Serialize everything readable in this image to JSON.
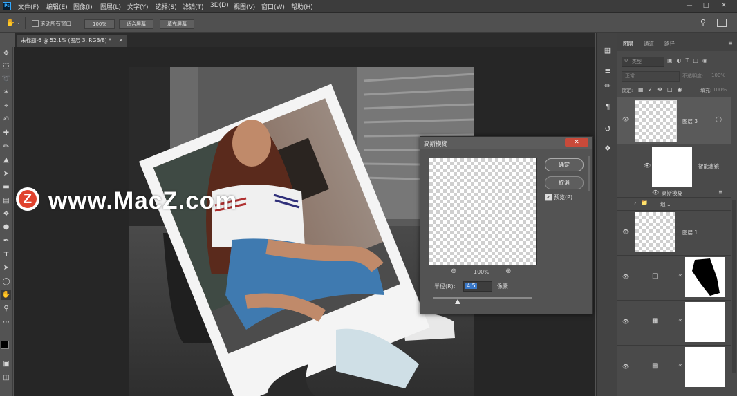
{
  "app": {
    "logo": "Ps"
  },
  "menubar": {
    "items": [
      "文件(F)",
      "编辑(E)",
      "图像(I)",
      "图层(L)",
      "文字(Y)",
      "选择(S)",
      "滤镜(T)",
      "3D(D)",
      "视图(V)",
      "窗口(W)",
      "帮助(H)"
    ]
  },
  "options": {
    "scroll_all_label": "滚动所有窗口",
    "zoom_value": "100%",
    "fit_screen_label": "适合屏幕",
    "fill_screen_label": "填充屏幕"
  },
  "document": {
    "tab_title": "未标题-6 @ 52.1% (图层 3, RGB/8) *",
    "tab_close": "×"
  },
  "layers_panel": {
    "tabs": [
      "图层",
      "通道",
      "路径"
    ],
    "search_placeholder": "类型",
    "blend_mode": "正常",
    "opacity_label": "不透明度:",
    "opacity_value": "100%",
    "lock_label": "锁定:",
    "fill_label": "填充:",
    "fill_value": "100%",
    "layers": [
      {
        "name": "图层 3"
      },
      {
        "name": "智能滤镜"
      },
      {
        "name": "高斯模糊"
      },
      {
        "name": "组 1"
      },
      {
        "name": "图层 1"
      }
    ]
  },
  "dialog": {
    "title": "高斯模糊",
    "close": "✕",
    "ok_label": "确定",
    "cancel_label": "取消",
    "preview_label": "预览(P)",
    "preview_checked": true,
    "zoom_value": "100%",
    "radius_label": "半径(R):",
    "radius_value": "4.5",
    "radius_unit": "像素",
    "radius_slider_fraction": 0.25
  },
  "watermark": {
    "badge": "Z",
    "text": "www.MacZ.com"
  },
  "colors": {
    "accent_blue": "#31a8ff",
    "close_red": "#c84a3a",
    "panel_bg": "#4a4a4a",
    "canvas_bg": "#262626"
  }
}
